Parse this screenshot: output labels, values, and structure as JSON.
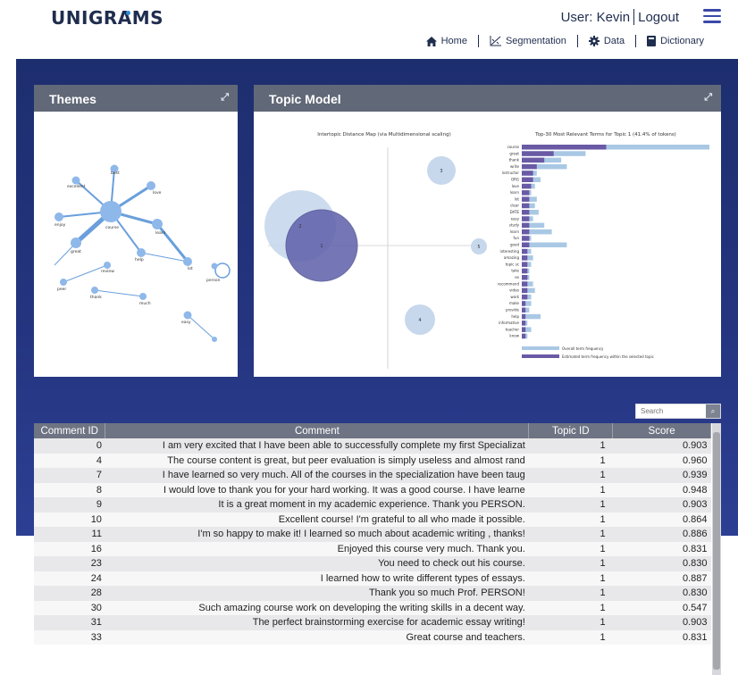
{
  "header": {
    "logo_pre": "UN",
    "logo_i": "I",
    "logo_post": "GRAMS",
    "user_label": "User: Kevin",
    "logout_label": "Logout"
  },
  "nav": {
    "items": [
      {
        "label": "Home",
        "icon": "home-icon"
      },
      {
        "label": "Segmentation",
        "icon": "chart-icon"
      },
      {
        "label": "Data",
        "icon": "gear-icon"
      },
      {
        "label": "Dictionary",
        "icon": "book-icon"
      }
    ]
  },
  "themes_panel": {
    "title": "Themes",
    "nodes": [
      {
        "label": "best"
      },
      {
        "label": "excellent"
      },
      {
        "label": "love"
      },
      {
        "label": "enjoy"
      },
      {
        "label": "course"
      },
      {
        "label": "learn"
      },
      {
        "label": "great"
      },
      {
        "label": "help"
      },
      {
        "label": "lot"
      },
      {
        "label": "person"
      },
      {
        "label": "review"
      },
      {
        "label": "peer"
      },
      {
        "label": "thank"
      },
      {
        "label": "much"
      },
      {
        "label": "easy"
      }
    ]
  },
  "topic_panel": {
    "title": "Topic Model",
    "left_title": "Intertopic Distance Map (via Multidimensional scaling)",
    "right_title": "Top-30 Most Relevant Terms for Topic 1 (41.4% of tokens)",
    "circles": [
      {
        "label": "1"
      },
      {
        "label": "2"
      },
      {
        "label": "3"
      },
      {
        "label": "4"
      },
      {
        "label": "5"
      }
    ],
    "legend": [
      {
        "label": "Overall term frequency",
        "color": "#a9c8e4"
      },
      {
        "label": "Estimated term frequency within the selected topic",
        "color": "#6a5aa5"
      }
    ],
    "terms": [
      {
        "term": "course",
        "overall": 1.0,
        "topic": 0.45
      },
      {
        "term": "great",
        "overall": 0.34,
        "topic": 0.17
      },
      {
        "term": "thank",
        "overall": 0.21,
        "topic": 0.12
      },
      {
        "term": "write",
        "overall": 0.24,
        "topic": 0.08
      },
      {
        "term": "instructor",
        "overall": 0.08,
        "topic": 0.06
      },
      {
        "term": "ORG",
        "overall": 0.1,
        "topic": 0.06
      },
      {
        "term": "love",
        "overall": 0.07,
        "topic": 0.05
      },
      {
        "term": "learn",
        "overall": 0.05,
        "topic": 0.04
      },
      {
        "term": "lot",
        "overall": 0.08,
        "topic": 0.04
      },
      {
        "term": "clear",
        "overall": 0.07,
        "topic": 0.04
      },
      {
        "term": "DATE",
        "overall": 0.09,
        "topic": 0.04
      },
      {
        "term": "easy",
        "overall": 0.06,
        "topic": 0.04
      },
      {
        "term": "study",
        "overall": 0.12,
        "topic": 0.04
      },
      {
        "term": "learn",
        "overall": 0.16,
        "topic": 0.04
      },
      {
        "term": "fun",
        "overall": 0.05,
        "topic": 0.04
      },
      {
        "term": "good",
        "overall": 0.24,
        "topic": 0.04
      },
      {
        "term": "interesting",
        "overall": 0.05,
        "topic": 0.03
      },
      {
        "term": "amazing",
        "overall": 0.06,
        "topic": 0.03
      },
      {
        "term": "topic sc",
        "overall": 0.05,
        "topic": 0.03
      },
      {
        "term": "take",
        "overall": 0.04,
        "topic": 0.03
      },
      {
        "term": "ex",
        "overall": 0.04,
        "topic": 0.03
      },
      {
        "term": "recommend",
        "overall": 0.06,
        "topic": 0.03
      },
      {
        "term": "video",
        "overall": 0.07,
        "topic": 0.03
      },
      {
        "term": "work",
        "overall": 0.05,
        "topic": 0.03
      },
      {
        "term": "make",
        "overall": 0.05,
        "topic": 0.02
      },
      {
        "term": "provide",
        "overall": 0.04,
        "topic": 0.02
      },
      {
        "term": "help",
        "overall": 0.1,
        "topic": 0.02
      },
      {
        "term": "informative",
        "overall": 0.03,
        "topic": 0.02
      },
      {
        "term": "teacher",
        "overall": 0.05,
        "topic": 0.02
      },
      {
        "term": "know",
        "overall": 0.03,
        "topic": 0.02
      }
    ]
  },
  "search": {
    "placeholder": "Search",
    "button_icon": "search-icon"
  },
  "table": {
    "headers": [
      "Comment ID",
      "Comment",
      "Topic ID",
      "Score"
    ],
    "rows": [
      {
        "id": "0",
        "comment": "I am very excited that I have been able to successfully complete my first Specializat",
        "topic": "1",
        "score": "0.903"
      },
      {
        "id": "4",
        "comment": "The course content is great, but peer evaluation is simply useless and almost rand",
        "topic": "1",
        "score": "0.960"
      },
      {
        "id": "7",
        "comment": "I have learned so very much. All of the courses in the specialization have been taug",
        "topic": "1",
        "score": "0.939"
      },
      {
        "id": "8",
        "comment": "I would love to thank you for your hard working. It was a good course. I have learne",
        "topic": "1",
        "score": "0.948"
      },
      {
        "id": "9",
        "comment": "It is a great moment in my academic experience. Thank you PERSON.",
        "topic": "1",
        "score": "0.903"
      },
      {
        "id": "10",
        "comment": "Excellent course! I'm grateful to all who made it possible.",
        "topic": "1",
        "score": "0.864"
      },
      {
        "id": "11",
        "comment": "I'm so happy to make it! I learned so much about academic writing , thanks!",
        "topic": "1",
        "score": "0.886"
      },
      {
        "id": "16",
        "comment": "Enjoyed this course very much. Thank you.",
        "topic": "1",
        "score": "0.831"
      },
      {
        "id": "23",
        "comment": "You need to check out his course.",
        "topic": "1",
        "score": "0.830"
      },
      {
        "id": "24",
        "comment": "I learned how to write different types of essays.",
        "topic": "1",
        "score": "0.887"
      },
      {
        "id": "28",
        "comment": "Thank you so much Prof. PERSON!",
        "topic": "1",
        "score": "0.830"
      },
      {
        "id": "30",
        "comment": "Such amazing course work on developing the writing skills in a decent way.",
        "topic": "1",
        "score": "0.547"
      },
      {
        "id": "31",
        "comment": "The perfect brainstorming exercise for academic essay writing!",
        "topic": "1",
        "score": "0.903"
      },
      {
        "id": "33",
        "comment": "Great course and teachers.",
        "topic": "1",
        "score": "0.831"
      }
    ]
  }
}
